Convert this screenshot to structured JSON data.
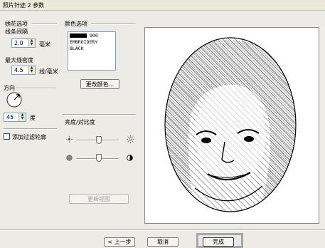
{
  "window": {
    "title": "照片针迹 2 参数"
  },
  "embroidery_options": {
    "heading": "绣花选项",
    "line_spacing_label": "线条间隔",
    "line_spacing_value": "2.0",
    "line_spacing_unit": "毫米",
    "max_density_label": "最大线密度",
    "max_density_value": "4.5",
    "max_density_unit": "线/毫米"
  },
  "direction": {
    "heading": "方向",
    "angle_value": "45",
    "angle_unit": "度"
  },
  "add_outline_label": "添加过滤轮廓",
  "color_options": {
    "heading": "颜色选项",
    "thread_number": "900",
    "thread_brand": "EMBROIDERY",
    "thread_name": "BLACK",
    "swatch_color": "#000000",
    "change_color_button": "更改颜色..."
  },
  "brightness_contrast": {
    "heading": "亮度/对比度"
  },
  "refresh_preview_button": "更新视图",
  "footer": {
    "back_button": "< 上一步",
    "cancel_button": "取消",
    "finish_button": "完成"
  }
}
